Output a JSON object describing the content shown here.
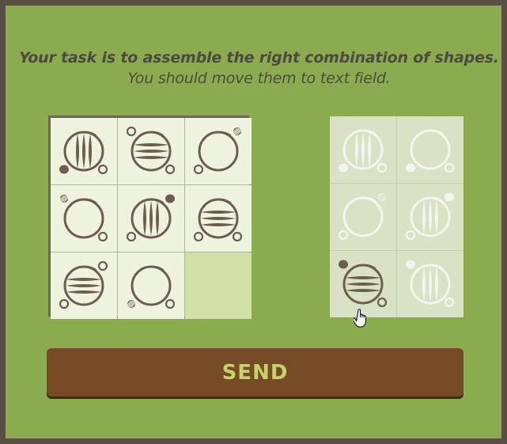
{
  "instructions": {
    "line1": "Your task is to assemble the right combination of shapes.",
    "line2": "You should move them to text field."
  },
  "colors": {
    "background": "#8aac4f",
    "border": "#5a4e45",
    "tile": "#eef3df",
    "empty_slot": "#d2e1a8",
    "shape_stroke": "#6b5e50",
    "button": "#774b27",
    "button_text": "#c6d36c"
  },
  "source_grid": [
    {
      "shape": "circle-vertical-bars",
      "dot_bottom_left": "solid",
      "dot_bottom_right": "ring"
    },
    {
      "shape": "circle-horizontal-bars",
      "dot_top_left": "ring",
      "dot_bottom_right": "ring"
    },
    {
      "shape": "circle-plain",
      "dot_top_right": "hatched",
      "dot_bottom_left": "ring"
    },
    {
      "shape": "circle-plain",
      "dot_top_left": "hatched",
      "dot_bottom_right": "ring"
    },
    {
      "shape": "circle-vertical-bars",
      "dot_top_right": "solid",
      "dot_bottom_left": "ring"
    },
    {
      "shape": "circle-horizontal-bars",
      "dot_bottom_left": "ring",
      "dot_bottom_right": "ring"
    },
    {
      "shape": "circle-horizontal-bars",
      "dot_top_right": "ring",
      "dot_bottom_left": "ring"
    },
    {
      "shape": "circle-plain",
      "dot_bottom_left": "hatched",
      "dot_bottom_right": "ring"
    },
    {
      "shape": "empty"
    }
  ],
  "target_grid": [
    {
      "shape": "circle-vertical-bars",
      "dot_bottom_left": "solid",
      "dot_bottom_right": "ring",
      "state": "hint"
    },
    {
      "shape": "circle-plain",
      "dot_bottom_left": "solid",
      "dot_bottom_right": "ring",
      "state": "hint"
    },
    {
      "shape": "circle-plain",
      "dot_top_right": "hatched",
      "dot_bottom_left": "ring",
      "state": "hint"
    },
    {
      "shape": "circle-vertical-bars",
      "dot_top_right": "solid",
      "dot_bottom_left": "ring",
      "state": "hint"
    },
    {
      "shape": "circle-horizontal-bars",
      "dot_top_left": "solid",
      "dot_bottom_right": "ring",
      "state": "placed"
    },
    {
      "shape": "circle-vertical-bars",
      "dot_top_left": "solid",
      "dot_bottom_right": "ring",
      "state": "hint"
    }
  ],
  "send_button": {
    "label": "SEND"
  },
  "cursor_icon": "hand-pointer-icon"
}
